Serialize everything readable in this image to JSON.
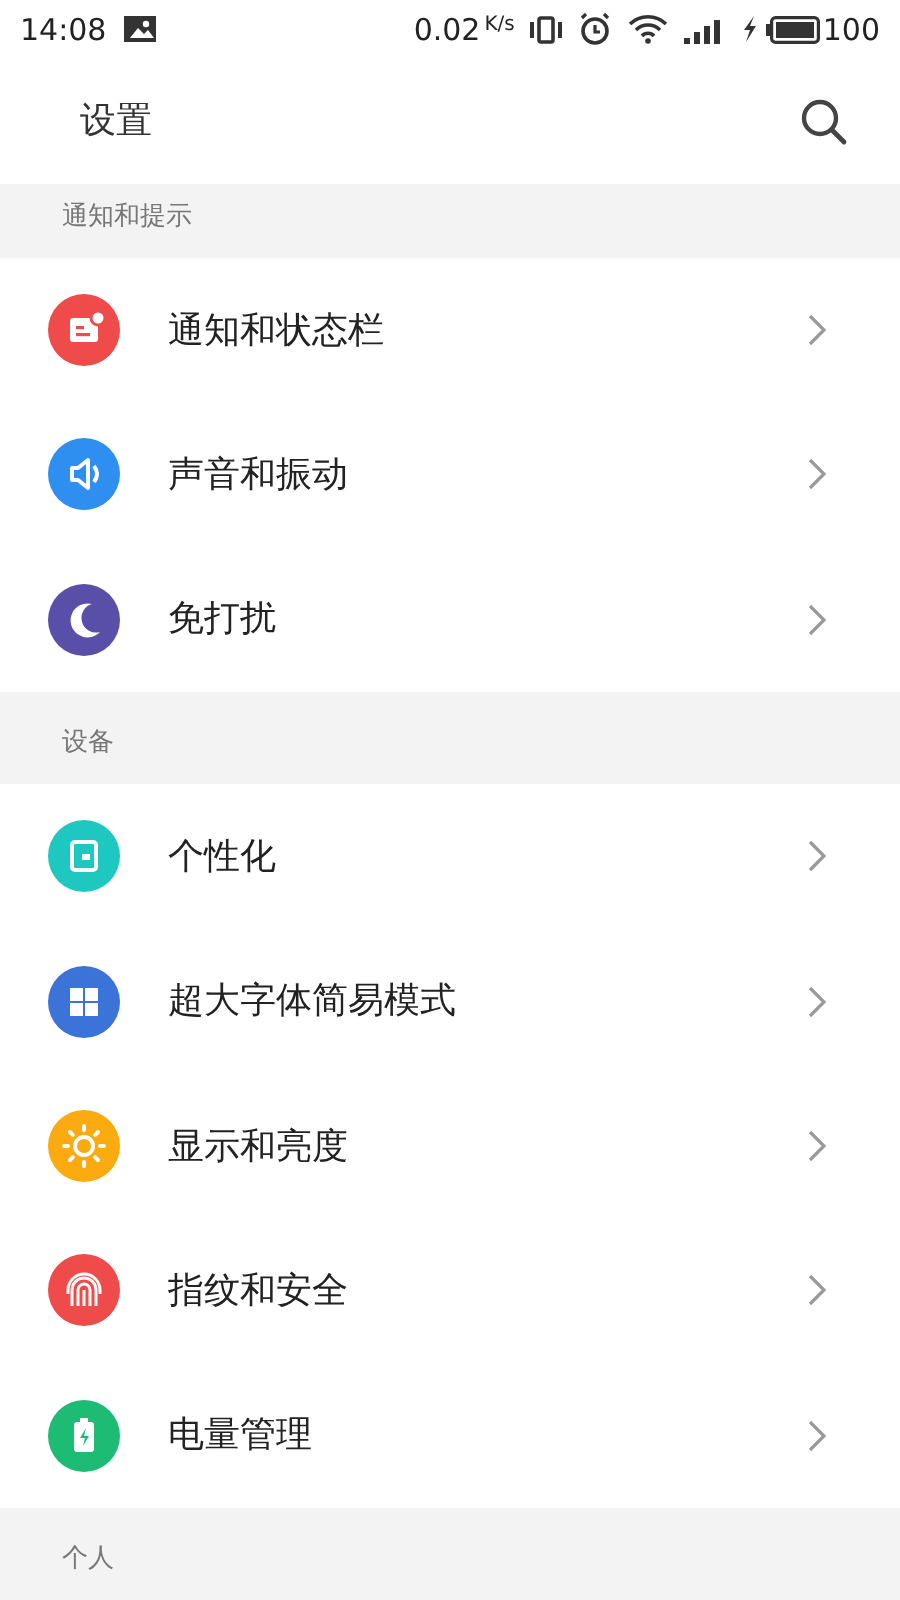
{
  "status_bar": {
    "time": "14:08",
    "speed": "0.02",
    "speed_unit": "K/s",
    "battery": "100"
  },
  "header": {
    "title": "设置"
  },
  "sections": [
    {
      "title": "通知和提示",
      "items": [
        {
          "label": "通知和状态栏",
          "kind": "notice",
          "color": "#ef4b4b"
        },
        {
          "label": "声音和振动",
          "kind": "sound",
          "color": "#2f8ff0"
        },
        {
          "label": "免打扰",
          "kind": "moon",
          "color": "#5a4fa8"
        }
      ]
    },
    {
      "title": "设备",
      "items": [
        {
          "label": "个性化",
          "kind": "theme",
          "color": "#1ec8c0"
        },
        {
          "label": "超大字体简易模式",
          "kind": "grid",
          "color": "#3b73d8"
        },
        {
          "label": "显示和亮度",
          "kind": "sun",
          "color": "#fbaa0f"
        },
        {
          "label": "指纹和安全",
          "kind": "fingerprint",
          "color": "#ef4b4b"
        },
        {
          "label": "电量管理",
          "kind": "battery",
          "color": "#1dbb74"
        }
      ]
    },
    {
      "title": "个人"
    }
  ]
}
